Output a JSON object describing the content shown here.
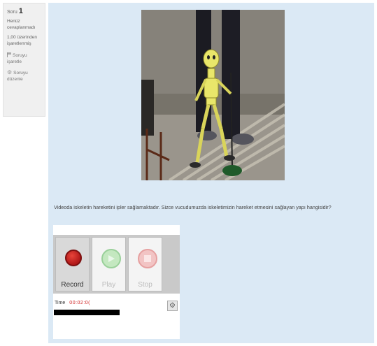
{
  "info": {
    "question_label": "Soru",
    "question_number": "1",
    "state": "Henüz cevaplanmadı",
    "marks": "1,00 üzerinden işaretlenmiş",
    "flag_label": "Soruyu işaretle",
    "edit_label": "Soruyu düzenle"
  },
  "question": {
    "text": "Videoda iskeletin hareketini ipler sağlamaktadır. Sizce vucudumuzda iskeletimizin hareket etmesini sağlayan yapı hangisidir?"
  },
  "recorder": {
    "record_label": "Record",
    "play_label": "Play",
    "stop_label": "Stop",
    "time_label": "Time",
    "time_value": "00:02:0(",
    "progress_fraction": 1.0
  }
}
